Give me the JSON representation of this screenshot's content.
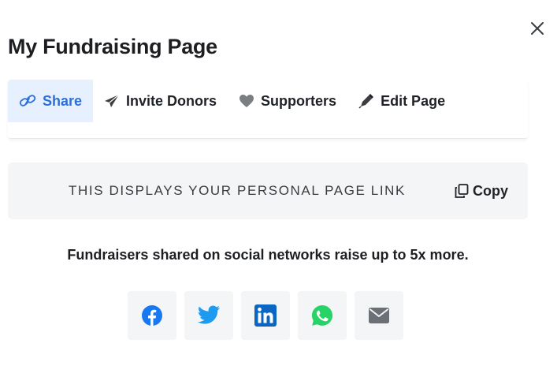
{
  "modal": {
    "title": "My Fundraising Page"
  },
  "tabs": [
    {
      "label": "Share",
      "icon": "link-icon",
      "active": true
    },
    {
      "label": "Invite Donors",
      "icon": "paper-plane-icon",
      "active": false
    },
    {
      "label": "Supporters",
      "icon": "heart-icon",
      "active": false
    },
    {
      "label": "Edit Page",
      "icon": "pen-icon",
      "active": false
    }
  ],
  "link_box": {
    "text": "THIS DISPLAYS YOUR PERSONAL PAGE LINK",
    "copy_label": "Copy"
  },
  "note": "Fundraisers shared on social networks raise up to 5x more.",
  "socials": [
    {
      "name": "facebook",
      "icon": "facebook-icon",
      "color": "#1877f2"
    },
    {
      "name": "twitter",
      "icon": "twitter-icon",
      "color": "#1d9bf0"
    },
    {
      "name": "linkedin",
      "icon": "linkedin-icon",
      "color": "#0a66c2"
    },
    {
      "name": "whatsapp",
      "icon": "whatsapp-icon",
      "color": "#25d366"
    },
    {
      "name": "email",
      "icon": "email-icon",
      "color": "#6b6f76"
    }
  ],
  "colors": {
    "accent": "#2c6fdb",
    "active_tab_bg": "#e6f0ff",
    "panel_bg": "#f4f5f6"
  }
}
